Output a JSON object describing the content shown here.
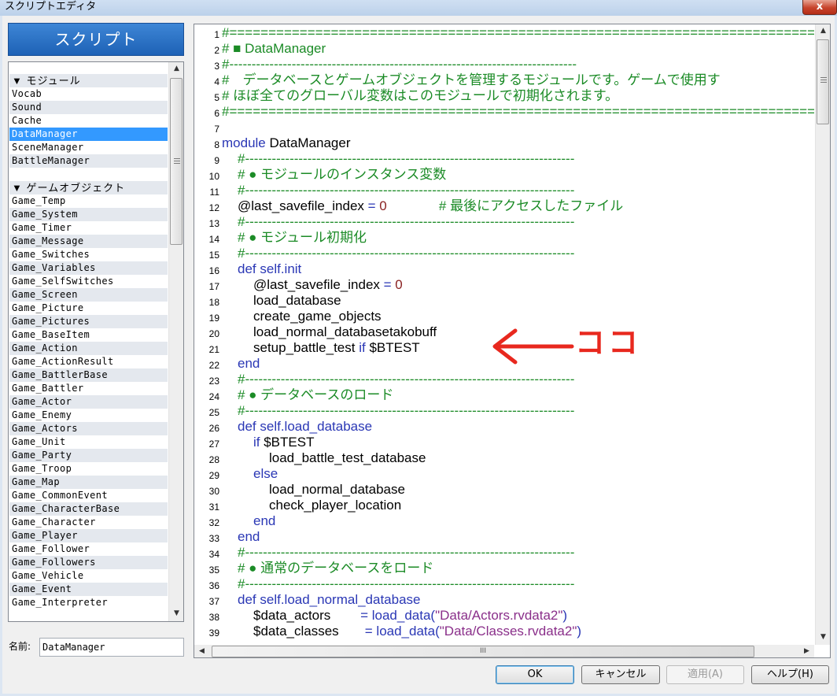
{
  "window": {
    "title": "スクリプトエディタ",
    "close_symbol": "x"
  },
  "sidebar": {
    "header": "スクリプト",
    "items": [
      {
        "label": "▼ モジュール",
        "group": true
      },
      {
        "label": "Vocab"
      },
      {
        "label": "Sound"
      },
      {
        "label": "Cache"
      },
      {
        "label": "DataManager",
        "selected": true
      },
      {
        "label": "SceneManager"
      },
      {
        "label": "BattleManager"
      },
      {
        "label": ""
      },
      {
        "label": "▼ ゲームオブジェクト",
        "group": true
      },
      {
        "label": "Game_Temp"
      },
      {
        "label": "Game_System"
      },
      {
        "label": "Game_Timer"
      },
      {
        "label": "Game_Message"
      },
      {
        "label": "Game_Switches"
      },
      {
        "label": "Game_Variables"
      },
      {
        "label": "Game_SelfSwitches"
      },
      {
        "label": "Game_Screen"
      },
      {
        "label": "Game_Picture"
      },
      {
        "label": "Game_Pictures"
      },
      {
        "label": "Game_BaseItem"
      },
      {
        "label": "Game_Action"
      },
      {
        "label": "Game_ActionResult"
      },
      {
        "label": "Game_BattlerBase"
      },
      {
        "label": "Game_Battler"
      },
      {
        "label": "Game_Actor"
      },
      {
        "label": "Game_Enemy"
      },
      {
        "label": "Game_Actors"
      },
      {
        "label": "Game_Unit"
      },
      {
        "label": "Game_Party"
      },
      {
        "label": "Game_Troop"
      },
      {
        "label": "Game_Map"
      },
      {
        "label": "Game_CommonEvent"
      },
      {
        "label": "Game_CharacterBase"
      },
      {
        "label": "Game_Character"
      },
      {
        "label": "Game_Player"
      },
      {
        "label": "Game_Follower"
      },
      {
        "label": "Game_Followers"
      },
      {
        "label": "Game_Vehicle"
      },
      {
        "label": "Game_Event"
      },
      {
        "label": "Game_Interpreter"
      }
    ]
  },
  "name_field": {
    "label": "名前:",
    "value": "DataManager"
  },
  "editor": {
    "lines": [
      {
        "n": "1",
        "indent": 0,
        "segs": [
          {
            "t": "#==============================================================================",
            "k": "comment"
          }
        ]
      },
      {
        "n": "2",
        "indent": 0,
        "segs": [
          {
            "t": "# ■ DataManager",
            "k": "comment"
          }
        ]
      },
      {
        "n": "3",
        "indent": 0,
        "segs": [
          {
            "t": "#------------------------------------------------------------------------------",
            "k": "comment"
          }
        ]
      },
      {
        "n": "4",
        "indent": 0,
        "segs": [
          {
            "t": "#　データベースとゲームオブジェクトを管理するモジュールです。ゲームで使用す",
            "k": "comment"
          }
        ]
      },
      {
        "n": "5",
        "indent": 0,
        "segs": [
          {
            "t": "# ほぼ全てのグローバル変数はこのモジュールで初期化されます。",
            "k": "comment"
          }
        ]
      },
      {
        "n": "6",
        "indent": 0,
        "segs": [
          {
            "t": "#==============================================================================",
            "k": "comment"
          }
        ]
      },
      {
        "n": "7",
        "indent": 0,
        "segs": []
      },
      {
        "n": "8",
        "indent": 0,
        "segs": [
          {
            "t": "module",
            "k": "keyword"
          },
          {
            "t": " DataManager",
            "k": "text"
          }
        ]
      },
      {
        "n": "9",
        "indent": 1,
        "segs": [
          {
            "t": "#--------------------------------------------------------------------------",
            "k": "comment"
          }
        ]
      },
      {
        "n": "10",
        "indent": 1,
        "segs": [
          {
            "t": "# ● モジュールのインスタンス変数",
            "k": "comment"
          }
        ]
      },
      {
        "n": "11",
        "indent": 1,
        "segs": [
          {
            "t": "#--------------------------------------------------------------------------",
            "k": "comment"
          }
        ]
      },
      {
        "n": "12",
        "indent": 1,
        "segs": [
          {
            "t": "@last_savefile_index ",
            "k": "text"
          },
          {
            "t": "=",
            "k": "keyword"
          },
          {
            "t": " 0",
            "k": "number"
          },
          {
            "t": "              # 最後にアクセスしたファイル",
            "k": "comment"
          }
        ]
      },
      {
        "n": "13",
        "indent": 1,
        "segs": [
          {
            "t": "#--------------------------------------------------------------------------",
            "k": "comment"
          }
        ]
      },
      {
        "n": "14",
        "indent": 1,
        "segs": [
          {
            "t": "# ● モジュール初期化",
            "k": "comment"
          }
        ]
      },
      {
        "n": "15",
        "indent": 1,
        "segs": [
          {
            "t": "#--------------------------------------------------------------------------",
            "k": "comment"
          }
        ]
      },
      {
        "n": "16",
        "indent": 1,
        "segs": [
          {
            "t": "def",
            "k": "keyword"
          },
          {
            "t": " self.init",
            "k": "keyword"
          }
        ]
      },
      {
        "n": "17",
        "indent": 2,
        "segs": [
          {
            "t": "@last_savefile_index ",
            "k": "text"
          },
          {
            "t": "=",
            "k": "keyword"
          },
          {
            "t": " 0",
            "k": "number"
          }
        ]
      },
      {
        "n": "18",
        "indent": 2,
        "segs": [
          {
            "t": "load_database",
            "k": "text"
          }
        ]
      },
      {
        "n": "19",
        "indent": 2,
        "segs": [
          {
            "t": "create_game_objects",
            "k": "text"
          }
        ]
      },
      {
        "n": "20",
        "indent": 2,
        "segs": [
          {
            "t": "load_normal_databasetakobuff",
            "k": "text"
          }
        ]
      },
      {
        "n": "21",
        "indent": 2,
        "segs": [
          {
            "t": "setup_battle_test ",
            "k": "text"
          },
          {
            "t": "if",
            "k": "keyword"
          },
          {
            "t": " $BTEST",
            "k": "text"
          }
        ]
      },
      {
        "n": "22",
        "indent": 1,
        "segs": [
          {
            "t": "end",
            "k": "keyword"
          }
        ]
      },
      {
        "n": "23",
        "indent": 1,
        "segs": [
          {
            "t": "#--------------------------------------------------------------------------",
            "k": "comment"
          }
        ]
      },
      {
        "n": "24",
        "indent": 1,
        "segs": [
          {
            "t": "# ● データベースのロード",
            "k": "comment"
          }
        ]
      },
      {
        "n": "25",
        "indent": 1,
        "segs": [
          {
            "t": "#--------------------------------------------------------------------------",
            "k": "comment"
          }
        ]
      },
      {
        "n": "26",
        "indent": 1,
        "segs": [
          {
            "t": "def",
            "k": "keyword"
          },
          {
            "t": " self.load_database",
            "k": "keyword"
          }
        ]
      },
      {
        "n": "27",
        "indent": 2,
        "segs": [
          {
            "t": "if",
            "k": "keyword"
          },
          {
            "t": " $BTEST",
            "k": "text"
          }
        ]
      },
      {
        "n": "28",
        "indent": 3,
        "segs": [
          {
            "t": "load_battle_test_database",
            "k": "text"
          }
        ]
      },
      {
        "n": "29",
        "indent": 2,
        "segs": [
          {
            "t": "else",
            "k": "keyword"
          }
        ]
      },
      {
        "n": "30",
        "indent": 3,
        "segs": [
          {
            "t": "load_normal_database",
            "k": "text"
          }
        ]
      },
      {
        "n": "31",
        "indent": 3,
        "segs": [
          {
            "t": "check_player_location",
            "k": "text"
          }
        ]
      },
      {
        "n": "32",
        "indent": 2,
        "segs": [
          {
            "t": "end",
            "k": "keyword"
          }
        ]
      },
      {
        "n": "33",
        "indent": 1,
        "segs": [
          {
            "t": "end",
            "k": "keyword"
          }
        ]
      },
      {
        "n": "34",
        "indent": 1,
        "segs": [
          {
            "t": "#--------------------------------------------------------------------------",
            "k": "comment"
          }
        ]
      },
      {
        "n": "35",
        "indent": 1,
        "segs": [
          {
            "t": "# ● 通常のデータベースをロード",
            "k": "comment"
          }
        ]
      },
      {
        "n": "36",
        "indent": 1,
        "segs": [
          {
            "t": "#--------------------------------------------------------------------------",
            "k": "comment"
          }
        ]
      },
      {
        "n": "37",
        "indent": 1,
        "segs": [
          {
            "t": "def",
            "k": "keyword"
          },
          {
            "t": " self.load_normal_database",
            "k": "keyword"
          }
        ]
      },
      {
        "n": "38",
        "indent": 2,
        "segs": [
          {
            "t": "$data_actors        ",
            "k": "text"
          },
          {
            "t": "=",
            "k": "keyword"
          },
          {
            "t": " load_data(",
            "k": "keyword"
          },
          {
            "t": "\"Data/Actors.rvdata2\"",
            "k": "string"
          },
          {
            "t": ")",
            "k": "keyword"
          }
        ]
      },
      {
        "n": "39",
        "indent": 2,
        "segs": [
          {
            "t": "$data_classes       ",
            "k": "text"
          },
          {
            "t": "=",
            "k": "keyword"
          },
          {
            "t": " load_data(",
            "k": "keyword"
          },
          {
            "t": "\"Data/Classes.rvdata2\"",
            "k": "string"
          },
          {
            "t": ")",
            "k": "keyword"
          }
        ]
      }
    ]
  },
  "annotation": {
    "label": "ココ",
    "color": "#e8281e"
  },
  "buttons": {
    "ok": "OK",
    "cancel": "キャンセル",
    "apply": "適用(A)",
    "help": "ヘルプ(H)"
  },
  "scroll_glyphs": {
    "up": "▲",
    "down": "▼",
    "left": "◀",
    "right": "▶",
    "h_grip": "III"
  }
}
